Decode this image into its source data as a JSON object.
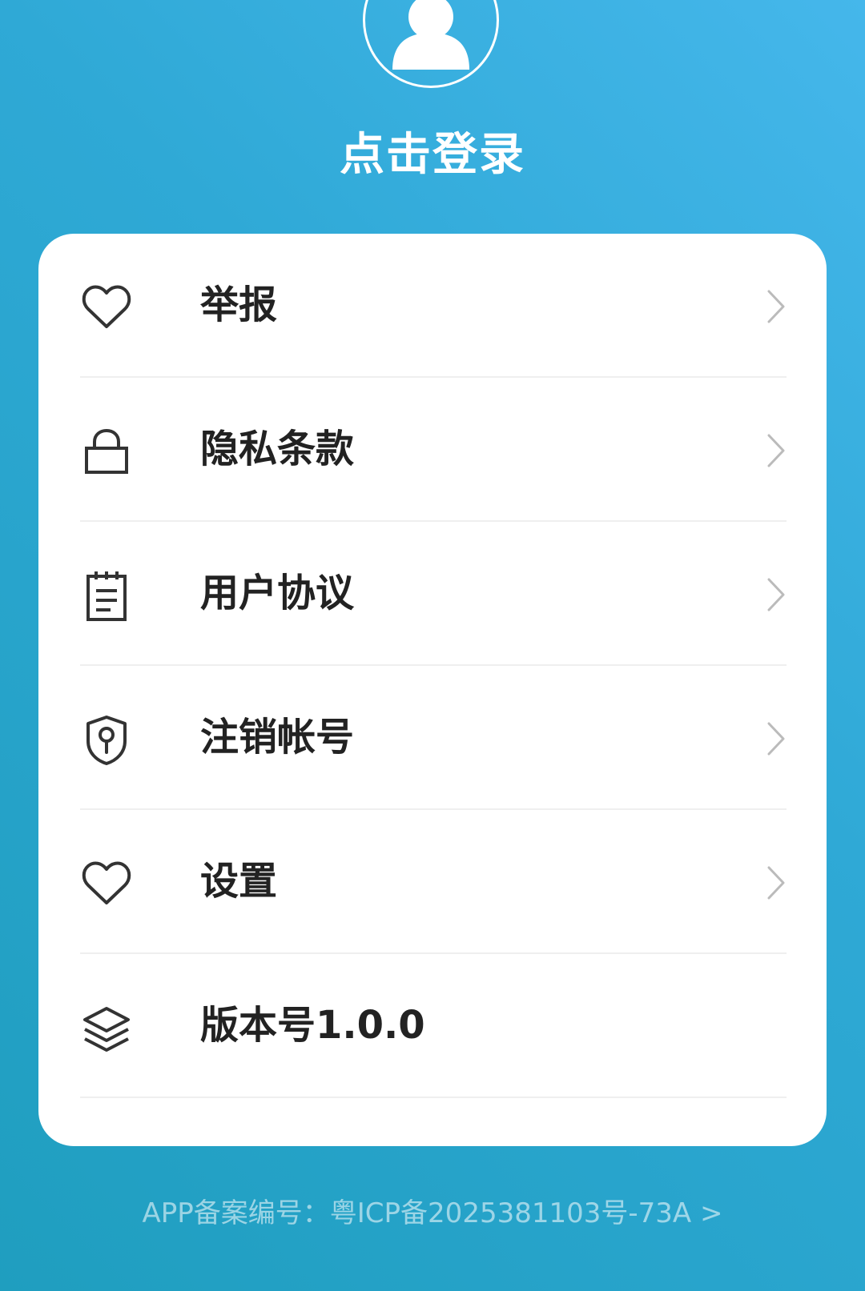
{
  "profile": {
    "login_label": "点击登录"
  },
  "menu": {
    "items": [
      {
        "label": "举报",
        "icon": "heart-icon"
      },
      {
        "label": "隐私条款",
        "icon": "lock-icon"
      },
      {
        "label": "用户协议",
        "icon": "notepad-icon"
      },
      {
        "label": "注销帐号",
        "icon": "shield-keyhole-icon"
      },
      {
        "label": "设置",
        "icon": "heart-icon"
      },
      {
        "label": "版本号1.0.0",
        "icon": "layers-icon"
      }
    ]
  },
  "footer": {
    "icp_text": "APP备案编号：粤ICP备2025381103号-73A >"
  },
  "colors": {
    "gradient_start": "#45b7eb",
    "gradient_end": "#1f9ebf",
    "card_bg": "#ffffff",
    "text_primary": "#222222",
    "chevron": "#bbbbbb"
  }
}
